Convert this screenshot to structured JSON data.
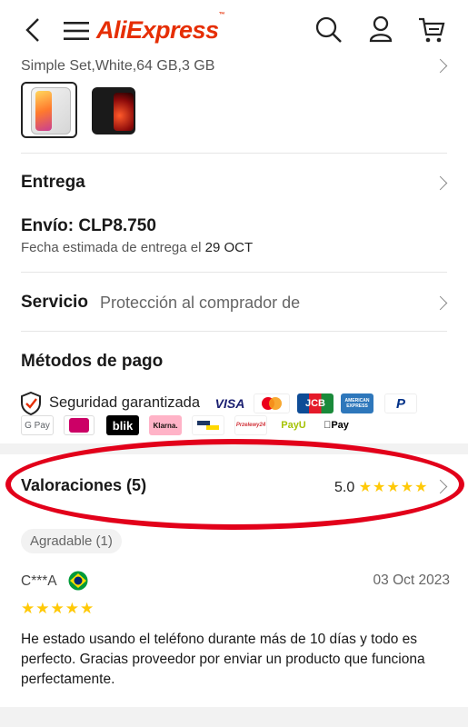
{
  "header": {
    "logo_text": "AliExpress",
    "logo_tm": "™",
    "back_icon": "back-arrow-icon",
    "menu_icon": "hamburger-icon",
    "search_icon": "search-icon",
    "account_icon": "user-icon",
    "cart_icon": "cart-icon",
    "brand_color": "#e62e04"
  },
  "variant": {
    "label": "Simple Set,White,64 GB,3 GB",
    "options": [
      "white-phone",
      "black-phone"
    ],
    "selected_index": 0
  },
  "delivery": {
    "title": "Entrega",
    "shipping": "Envío: CLP8.750",
    "estimate_prefix": "Fecha estimada de entrega el",
    "estimate_date": "29 OCT"
  },
  "service": {
    "title": "Servicio",
    "value": "Protección al comprador de"
  },
  "payment": {
    "title": "Métodos de pago",
    "security_label": "Seguridad garantizada",
    "methods_row1": [
      "VISA",
      "",
      "JCB",
      "AMERICAN EXPRESS",
      "P"
    ],
    "methods_row2": [
      "G Pay",
      "",
      "blik",
      "Klarna.",
      "",
      "Przelewy24",
      "PayU",
      "Pay"
    ]
  },
  "reviews": {
    "title": "Valoraciones (5)",
    "rating": "5.0",
    "stars": 5,
    "filter_chip": "Agradable (1)",
    "items": [
      {
        "author": "C***A",
        "date": "03 Oct 2023",
        "stars": 5,
        "text": "He estado usando el teléfono durante más de 10 días y todo es perfecto. Gracias proveedor por enviar un producto que funciona perfectamente."
      }
    ]
  },
  "annotation_color": "#e2001a"
}
